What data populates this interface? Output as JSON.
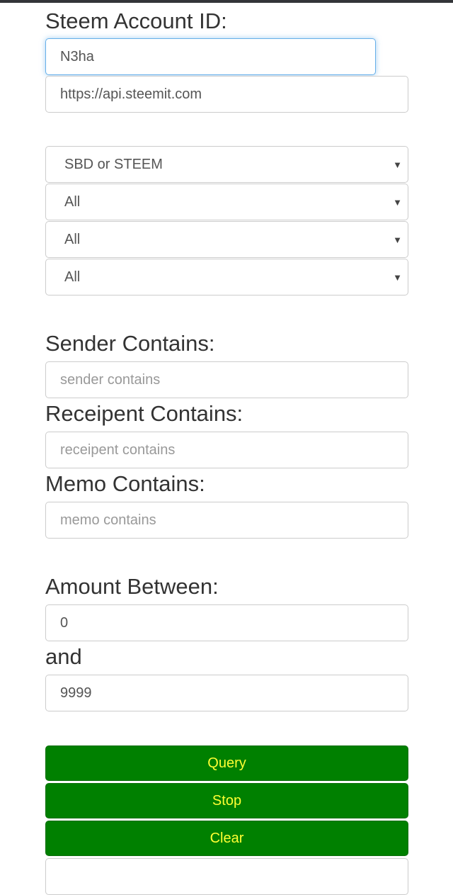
{
  "form": {
    "account_label": "Steem Account ID:",
    "account_value": "N3ha",
    "api_value": "https://api.steemit.com",
    "selects": [
      "SBD or STEEM",
      "All",
      "All",
      "All"
    ],
    "sender_label": "Sender Contains:",
    "sender_placeholder": "sender contains",
    "recipient_label": "Receipent Contains:",
    "recipient_placeholder": "receipent contains",
    "memo_label": "Memo Contains:",
    "memo_placeholder": "memo contains",
    "amount_label": "Amount Between:",
    "amount_min": "0",
    "and_label": "and",
    "amount_max": "9999"
  },
  "buttons": {
    "query": "Query",
    "stop": "Stop",
    "clear": "Clear"
  },
  "colors": {
    "button_bg": "#008000",
    "button_text": "#ffff33",
    "focus": "#66afe9"
  }
}
